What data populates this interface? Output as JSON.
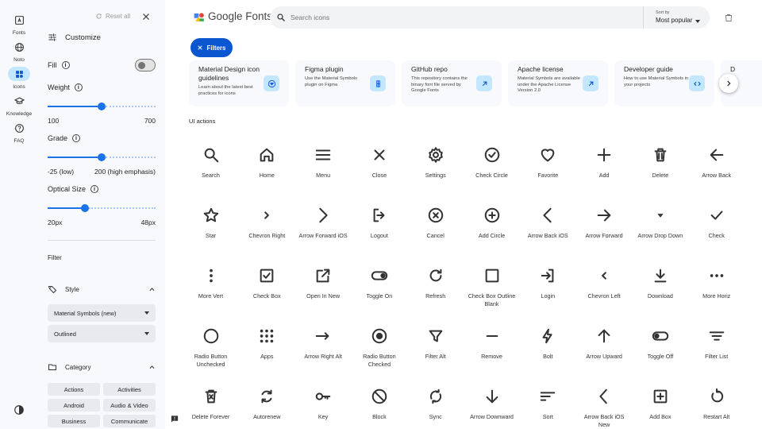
{
  "rail": [
    {
      "label": "Fonts",
      "icon": "fonts-icon"
    },
    {
      "label": "Noto",
      "icon": "globe-icon"
    },
    {
      "label": "Icons",
      "icon": "icons-icon",
      "active": true
    },
    {
      "label": "Knowledge",
      "icon": "knowledge-icon"
    },
    {
      "label": "FAQ",
      "icon": "help-icon"
    }
  ],
  "panel": {
    "reset_label": "Reset all",
    "customize_label": "Customize",
    "fill_label": "Fill",
    "weight_label": "Weight",
    "weight_min": "100",
    "weight_max": "700",
    "weight_value": 0.5,
    "grade_label": "Grade",
    "grade_min": "-25 (low)",
    "grade_max": "200 (high emphasis)",
    "grade_value": 0.5,
    "optical_label": "Optical Size",
    "optical_min": "20px",
    "optical_max": "48px",
    "optical_value": 0.33,
    "filter_label": "Filter",
    "style_label": "Style",
    "style_select": "Material Symbols (new)",
    "style_variant": "Outlined",
    "category_label": "Category",
    "chips": [
      "Actions",
      "Activities",
      "Android",
      "Audio & Video",
      "Business",
      "Communicate"
    ]
  },
  "header": {
    "logo_text": "Google Fonts",
    "search_placeholder": "Search icons",
    "sort_caption": "Sort by",
    "sort_value": "Most popular"
  },
  "filters_label": "Filters",
  "cards": [
    {
      "title": "Material Design icon guidelines",
      "desc": "Learn about the latest best practices for icons",
      "icon": "material-icon"
    },
    {
      "title": "Figma plugin",
      "desc": "Use the Material Symbols plugin on Figma",
      "icon": "figma-icon"
    },
    {
      "title": "GitHub repo",
      "desc": "This repository contains the binary font file served by Google Fonts",
      "icon": "external-link-icon"
    },
    {
      "title": "Apache license",
      "desc": "Material Symbols are available under the Apache License Version 2.0",
      "icon": "external-link-icon"
    },
    {
      "title": "Developer guide",
      "desc": "How to use Material Symbols in your projects",
      "icon": "code-icon"
    },
    {
      "title": "D",
      "desc": "",
      "icon": "external-link-icon"
    }
  ],
  "section_title": "UI actions",
  "icons": [
    {
      "name": "Search",
      "icon": "search"
    },
    {
      "name": "Home",
      "icon": "home"
    },
    {
      "name": "Menu",
      "icon": "menu"
    },
    {
      "name": "Close",
      "icon": "close"
    },
    {
      "name": "Settings",
      "icon": "settings"
    },
    {
      "name": "Check Circle",
      "icon": "check_circle"
    },
    {
      "name": "Favorite",
      "icon": "favorite"
    },
    {
      "name": "Add",
      "icon": "add"
    },
    {
      "name": "Delete",
      "icon": "delete"
    },
    {
      "name": "Arrow Back",
      "icon": "arrow_back"
    },
    {
      "name": "Star",
      "icon": "star"
    },
    {
      "name": "Chevron Right",
      "icon": "chevron_right"
    },
    {
      "name": "Arrow Forward iOS",
      "icon": "arrow_forward_ios"
    },
    {
      "name": "Logout",
      "icon": "logout"
    },
    {
      "name": "Cancel",
      "icon": "cancel"
    },
    {
      "name": "Add Circle",
      "icon": "add_circle"
    },
    {
      "name": "Arrow Back iOS",
      "icon": "arrow_back_ios"
    },
    {
      "name": "Arrow Forward",
      "icon": "arrow_forward"
    },
    {
      "name": "Arrow Drop Down",
      "icon": "arrow_drop_down"
    },
    {
      "name": "Check",
      "icon": "check"
    },
    {
      "name": "More Vert",
      "icon": "more_vert"
    },
    {
      "name": "Check Box",
      "icon": "check_box"
    },
    {
      "name": "Open In New",
      "icon": "open_in_new"
    },
    {
      "name": "Toggle On",
      "icon": "toggle_on"
    },
    {
      "name": "Refresh",
      "icon": "refresh"
    },
    {
      "name": "Check Box Outline Blank",
      "icon": "check_box_outline_blank"
    },
    {
      "name": "Login",
      "icon": "login"
    },
    {
      "name": "Chevron Left",
      "icon": "chevron_left"
    },
    {
      "name": "Download",
      "icon": "download"
    },
    {
      "name": "More Horiz",
      "icon": "more_horiz"
    },
    {
      "name": "Radio Button Unchecked",
      "icon": "radio_button_unchecked"
    },
    {
      "name": "Apps",
      "icon": "apps"
    },
    {
      "name": "Arrow Right Alt",
      "icon": "arrow_right_alt"
    },
    {
      "name": "Radio Button Checked",
      "icon": "radio_button_checked"
    },
    {
      "name": "Filter Alt",
      "icon": "filter_alt"
    },
    {
      "name": "Remove",
      "icon": "remove"
    },
    {
      "name": "Bolt",
      "icon": "bolt"
    },
    {
      "name": "Arrow Upward",
      "icon": "arrow_upward"
    },
    {
      "name": "Toggle Off",
      "icon": "toggle_off"
    },
    {
      "name": "Filter List",
      "icon": "filter_list"
    },
    {
      "name": "Delete Forever",
      "icon": "delete_forever"
    },
    {
      "name": "Autorenew",
      "icon": "autorenew"
    },
    {
      "name": "Key",
      "icon": "key"
    },
    {
      "name": "Block",
      "icon": "block"
    },
    {
      "name": "Sync",
      "icon": "sync"
    },
    {
      "name": "Arrow Downward",
      "icon": "arrow_downward"
    },
    {
      "name": "Sort",
      "icon": "sort"
    },
    {
      "name": "Arrow Back iOS New",
      "icon": "arrow_back_ios_new"
    },
    {
      "name": "Add Box",
      "icon": "add_box"
    },
    {
      "name": "Restart Alt",
      "icon": "restart_alt"
    }
  ],
  "colors": {
    "accent": "#0b57d0",
    "slider": "#1a73e8",
    "chip_bg": "#c2e7ff",
    "panel_bg": "#f8f9fc"
  }
}
